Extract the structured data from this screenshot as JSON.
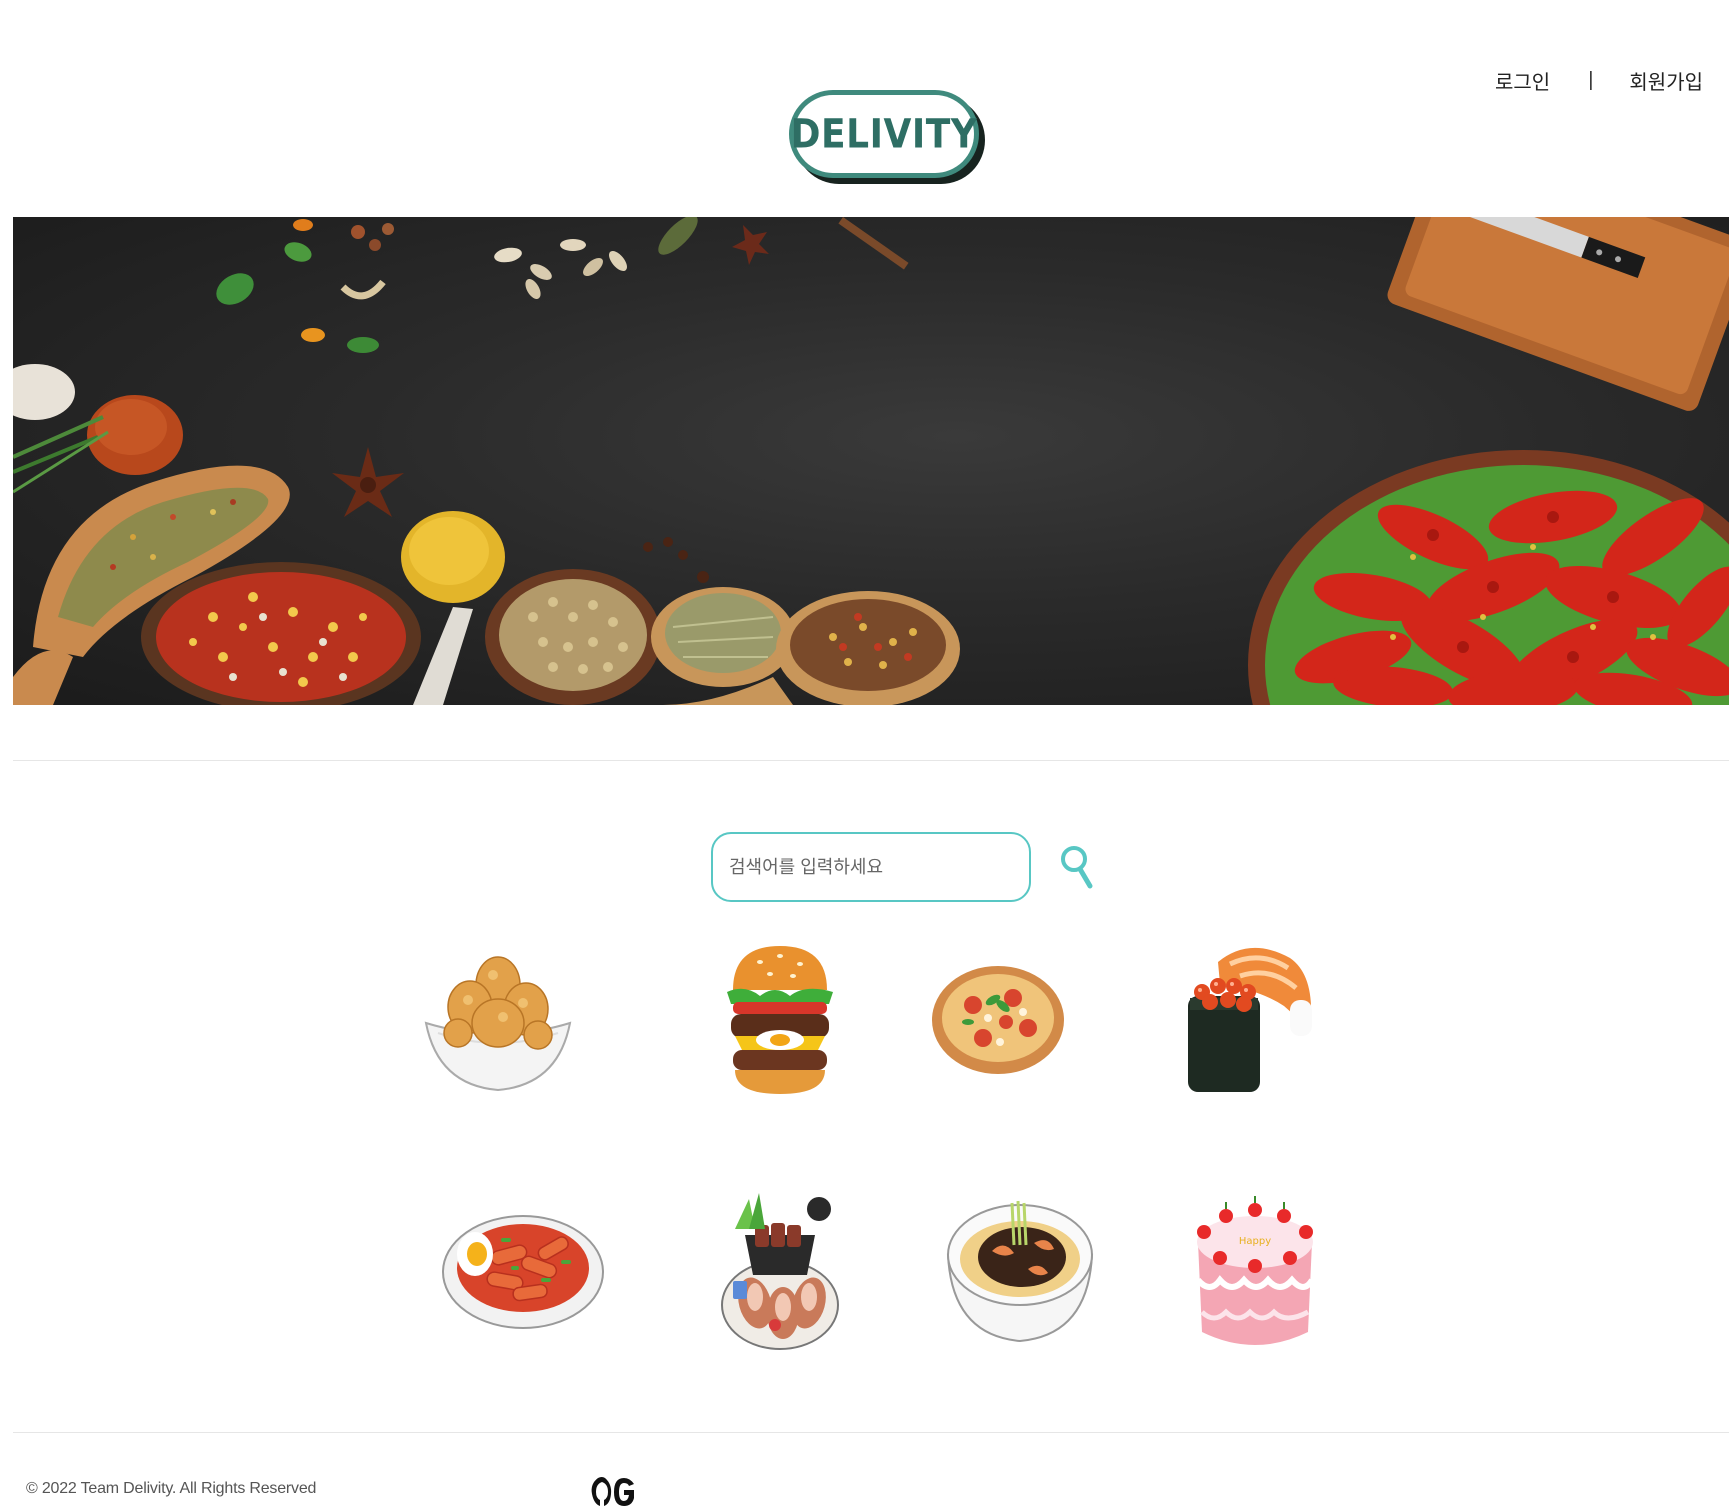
{
  "header": {
    "login_label": "로그인",
    "separator": "|",
    "signup_label": "회원가입",
    "logo_text": "DELIVITY"
  },
  "colors": {
    "brand": "#3f8a7d",
    "brand_text": "#2e6e64",
    "search_accent": "#58c7c4"
  },
  "search": {
    "placeholder": "검색어를 입력하세요",
    "value": "",
    "icon": "search-icon"
  },
  "menu": {
    "items": [
      {
        "icon": "fried-chicken-icon"
      },
      {
        "icon": "hamburger-icon"
      },
      {
        "icon": "pizza-icon"
      },
      {
        "icon": "sushi-icon"
      },
      {
        "icon": "tteokbokki-icon"
      },
      {
        "icon": "jokbal-icon"
      },
      {
        "icon": "jjajangmyeon-icon"
      },
      {
        "icon": "cake-icon"
      }
    ]
  },
  "footer": {
    "copyright": "© 2022 Team Delivity. All Rights Reserved",
    "github_icon": "github-icon"
  }
}
